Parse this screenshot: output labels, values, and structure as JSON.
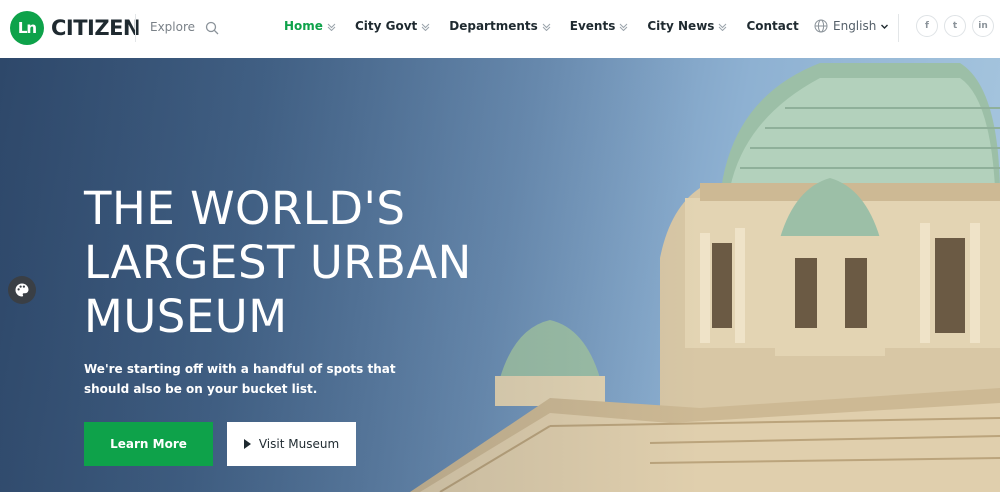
{
  "brand": {
    "logo_mark": "Ln",
    "name": "CITIZEN"
  },
  "header": {
    "explore_label": "Explore",
    "search_icon": "search-icon",
    "nav": [
      {
        "label": "Home",
        "active": true,
        "has_dropdown": true
      },
      {
        "label": "City Govt",
        "active": false,
        "has_dropdown": true
      },
      {
        "label": "Departments",
        "active": false,
        "has_dropdown": true
      },
      {
        "label": "Events",
        "active": false,
        "has_dropdown": true
      },
      {
        "label": "City News",
        "active": false,
        "has_dropdown": true
      },
      {
        "label": "Contact",
        "active": false,
        "has_dropdown": false
      }
    ],
    "language": "English",
    "social": [
      {
        "name": "facebook-icon",
        "glyph": "f"
      },
      {
        "name": "twitter-icon",
        "glyph": "t"
      },
      {
        "name": "linkedin-icon",
        "glyph": "in"
      }
    ]
  },
  "hero": {
    "title": "THE WORLD'S LARGEST URBAN MUSEUM",
    "subtitle": "We're starting off with a handful of spots that should also be on your bucket list.",
    "primary_button": "Learn More",
    "secondary_button": "Visit Museum"
  },
  "colors": {
    "accent": "#0ea24a",
    "text_dark": "#1f2a30",
    "sky": "#6c8fb4"
  }
}
